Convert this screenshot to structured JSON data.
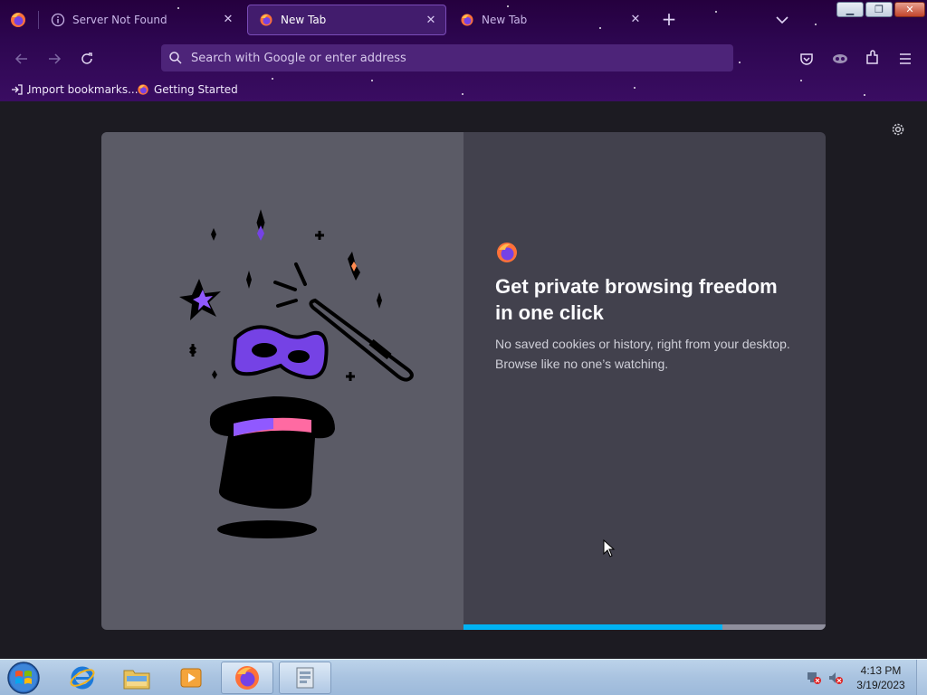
{
  "tabs": [
    {
      "title": "Server Not Found",
      "icon": "info-icon",
      "active": false
    },
    {
      "title": "New Tab",
      "icon": "firefox-icon",
      "active": true
    },
    {
      "title": "New Tab",
      "icon": "firefox-icon",
      "active": false
    }
  ],
  "navbar": {
    "search_placeholder": "Search with Google or enter address"
  },
  "bookmarks": [
    {
      "label": "Import bookmarks...",
      "icon": "import-icon"
    },
    {
      "label": "Getting Started",
      "icon": "firefox-icon"
    }
  ],
  "promo": {
    "title": "Get private browsing freedom in one click",
    "body": "No saved cookies or history, right from your desktop. Browse like no one’s watching.",
    "progress": 0.715
  },
  "taskbar": {
    "items": [
      "internet-explorer-icon",
      "file-explorer-icon",
      "media-player-icon",
      "firefox-icon",
      "app-icon"
    ],
    "time": "4:13 PM",
    "date": "3/19/2023"
  },
  "colors": {
    "private_purple": "#2d0650",
    "modal_left": "#5b5b66",
    "modal_right": "#42414d",
    "progress": "#00b3f4"
  }
}
